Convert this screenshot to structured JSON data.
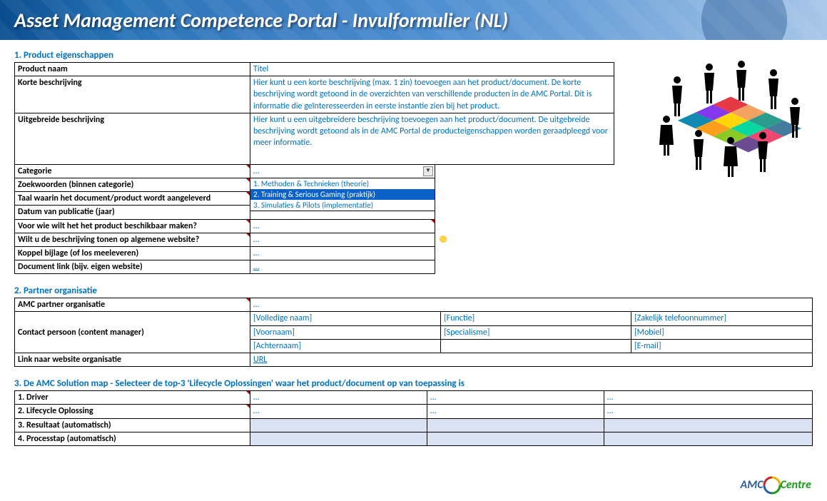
{
  "header": {
    "title": "Asset Management Competence Portal - Invulformulier (NL)"
  },
  "section1": {
    "title": "1. Product eigenschappen",
    "rows": {
      "product_naam": {
        "label": "Product naam",
        "value": "Titel"
      },
      "korte_beschrijving": {
        "label": "Korte beschrijving",
        "value": "Hier kunt u een korte beschrijving (max. 1 zin) toevoegen aan het product/document. De korte beschrijving wordt getoond in de overzichten van verschillende producten in de AMC Portal. Dit is informatie die geïnteresseerden in eerste instantie zien bij het product."
      },
      "uitgebreide_beschrijving": {
        "label": "Uitgebreide beschrijving",
        "value": "Hier kunt u een uitgebreidere beschrijving toevoegen aan het product/document. De uitgebreide beschrijving wordt getoond als in de AMC Portal de producteigenschappen worden geraadpleegd voor meer informatie."
      },
      "categorie": {
        "label": "Categorie",
        "value": "…",
        "options": [
          "1. Methoden & Technieken (theorie)",
          "2. Training & Serious Gaming (praktijk)",
          "3. Simulaties & Pilots (implementatie)"
        ],
        "highlighted_index": 1
      },
      "zoekwoorden": {
        "label": "Zoekwoorden (binnen categorie)"
      },
      "taal": {
        "label": "Taal waarin het document/product wordt aangeleverd"
      },
      "datum": {
        "label": "Datum van publicatie (jaar)"
      },
      "voor_wie": {
        "label": "Voor wie wilt het het product beschikbaar maken?",
        "value": "…"
      },
      "tonen_website": {
        "label": "Wilt u de beschrijving tonen op algemene website?",
        "value": "…"
      },
      "koppel_bijlage": {
        "label": "Koppel bijlage (of los meeleveren)",
        "value": "…"
      },
      "document_link": {
        "label": "Document link (bijv. eigen website)",
        "value": "…"
      }
    }
  },
  "section2": {
    "title": "2. Partner organisatie",
    "rows": {
      "amc_partner": {
        "label": "AMC partner organisatie",
        "value": "…"
      },
      "contact_persoon": {
        "label": "Contact persoon (content manager)",
        "col1": [
          "[Volledige naam]",
          "[Voornaam]",
          "[Achternaam]"
        ],
        "col2": [
          "[Functie]",
          "[Specialisme]",
          ""
        ],
        "col3": [
          "[Zakelijk telefoonnummer]",
          "[Mobiel]",
          "[E-mail]"
        ]
      },
      "link_website": {
        "label": "Link naar website organisatie",
        "value": "URL"
      }
    }
  },
  "section3": {
    "title": "3. De AMC Solution map - Selecteer de top-3 'Lifecycle Oplossingen' waar het product/document op van toepassing is",
    "rows": [
      {
        "label": "1. Driver",
        "v": [
          "…",
          "…",
          "…"
        ],
        "auto": false
      },
      {
        "label": "2. Lifecycle Oplossing",
        "v": [
          "…",
          "…",
          "…"
        ],
        "auto": false
      },
      {
        "label": "3. Resultaat (automatisch)",
        "v": [
          "",
          "",
          ""
        ],
        "auto": true
      },
      {
        "label": "4. Processtap (automatisch)",
        "v": [
          "",
          "",
          ""
        ],
        "auto": true
      }
    ]
  },
  "logo": {
    "part1": "AMC",
    "part2": "Centre"
  }
}
